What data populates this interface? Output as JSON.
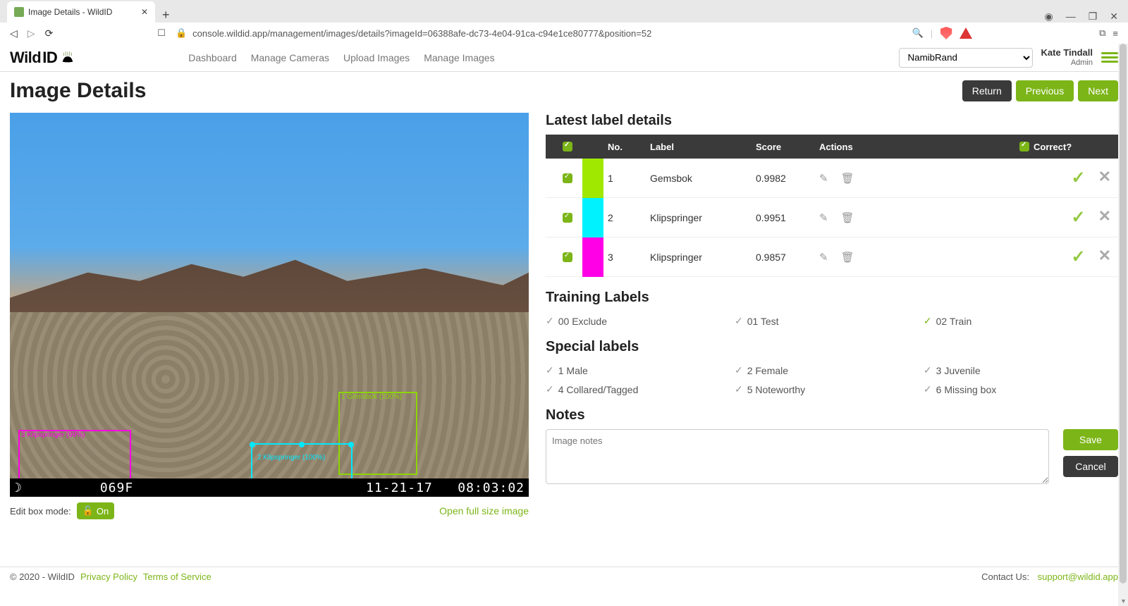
{
  "browser": {
    "tab_title": "Image Details - WildID",
    "url": "console.wildid.app/management/images/details?imageId=06388afe-dc73-4e04-91ca-c94e1ce80777&position=52"
  },
  "header": {
    "logo_text_1": "Wild",
    "logo_text_2": "ID",
    "nav": {
      "dashboard": "Dashboard",
      "cameras": "Manage Cameras",
      "upload": "Upload Images",
      "images": "Manage Images"
    },
    "project": "NamibRand",
    "user_name": "Kate Tindall",
    "user_role": "Admin"
  },
  "page": {
    "title": "Image Details",
    "btn_return": "Return",
    "btn_prev": "Previous",
    "btn_next": "Next"
  },
  "image": {
    "footer_left": "069F",
    "footer_date": "11-21-17",
    "footer_time": "08:03:02",
    "boxes": {
      "b1": "1 Gemsbok (100%)",
      "b2": "2 Klipspringer (100%)",
      "b3": "3 Klipspringer (99%)"
    },
    "edit_box_mode_label": "Edit box mode:",
    "toggle_text": "On",
    "open_full": "Open full size image"
  },
  "labels": {
    "heading": "Latest label details",
    "th_no": "No.",
    "th_label": "Label",
    "th_score": "Score",
    "th_actions": "Actions",
    "th_correct": "Correct?",
    "rows": [
      {
        "no": "1",
        "label": "Gemsbok",
        "score": "0.9982",
        "color": "#a0e800"
      },
      {
        "no": "2",
        "label": "Klipspringer",
        "score": "0.9951",
        "color": "#00f2ff"
      },
      {
        "no": "3",
        "label": "Klipspringer",
        "score": "0.9857",
        "color": "#ff00e6"
      }
    ]
  },
  "training": {
    "heading": "Training Labels",
    "t0": "00 Exclude",
    "t1": "01 Test",
    "t2": "02 Train"
  },
  "special": {
    "heading": "Special labels",
    "s1": "1 Male",
    "s2": "2 Female",
    "s3": "3 Juvenile",
    "s4": "4 Collared/Tagged",
    "s5": "5 Noteworthy",
    "s6": "6 Missing box"
  },
  "notes": {
    "heading": "Notes",
    "placeholder": "Image notes",
    "save": "Save",
    "cancel": "Cancel"
  },
  "footer": {
    "copyright": "© 2020 - WildID",
    "privacy": "Privacy Policy",
    "terms": "Terms of Service",
    "contact_label": "Contact Us: ",
    "contact_email": "support@wildid.app"
  }
}
